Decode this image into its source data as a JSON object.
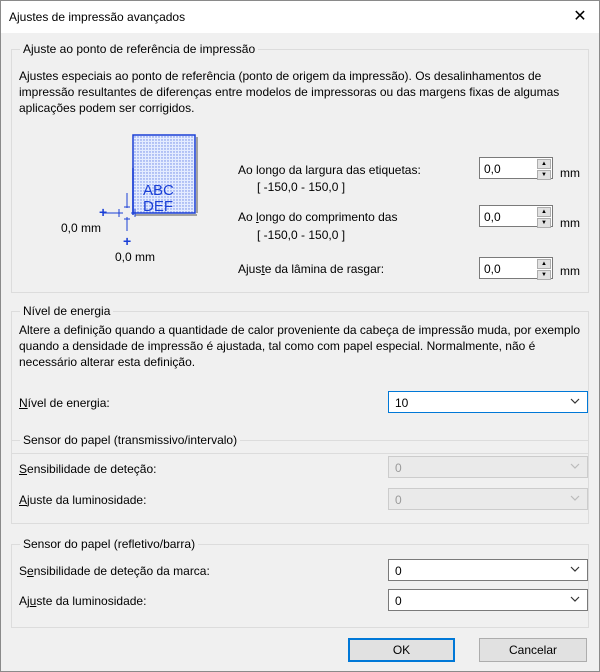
{
  "window": {
    "title": "Ajustes de impressão avançados",
    "close_glyph": "✕"
  },
  "reference": {
    "legend": "Ajuste ao ponto de referência de impressão",
    "description": "Ajustes especiais ao ponto de referência (ponto de origem da impressão). Os desalinhamentos de impressão resultantes de diferenças entre modelos de impressoras ou das margens fixas de algumas aplicações podem ser corrigidos.",
    "diagram": {
      "line1": "ABC",
      "line2": "DEF",
      "left_label": "0,0 mm",
      "bottom_label": "0,0 mm"
    },
    "width_label": "Ao longo da largura das etiquetas:",
    "width_range": "[ -150,0 - 150,0 ]",
    "width_value": "0,0",
    "length_label": "Ao longo do comprimento das",
    "length_range": "[ -150,0 - 150,0 ]",
    "length_value": "0,0",
    "tear_label": "Ajuste da lâmina de rasgar:",
    "tear_value": "0,0",
    "unit": "mm"
  },
  "energy": {
    "legend": "Nível de energia",
    "description": "Altere a definição quando a quantidade de calor proveniente da cabeça de impressão muda, por exemplo quando a densidade de impressão é ajustada, tal como com papel especial. Normalmente, não é necessário alterar esta definição.",
    "label": "Nível de energia:",
    "value": "10"
  },
  "sensor_transmissive": {
    "legend": "Sensor do papel (transmissivo/intervalo)",
    "sensitivity_label": "Sensibilidade de deteção:",
    "sensitivity_value": "0",
    "brightness_label": "Ajuste da luminosidade:",
    "brightness_value": "0"
  },
  "sensor_reflective": {
    "legend": "Sensor do papel (refletivo/barra)",
    "sensitivity_label": "Sensibilidade de deteção da marca:",
    "sensitivity_value": "0",
    "brightness_label": "Ajuste da luminosidade:",
    "brightness_value": "0"
  },
  "buttons": {
    "ok": "OK",
    "cancel": "Cancelar"
  },
  "colors": {
    "accent": "#0078d7",
    "disabled_bg": "#eaeaea",
    "diagram_blue": "#1a3fd6"
  }
}
